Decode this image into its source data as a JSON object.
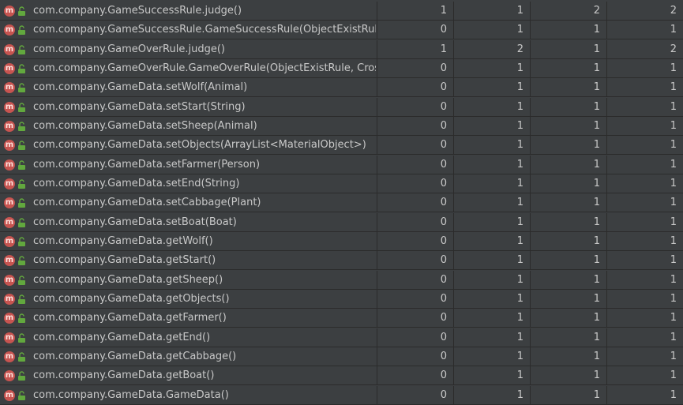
{
  "icons": {
    "method_icon": "m",
    "visibility_icon": "unlock-icon"
  },
  "colors": {
    "background": "#3c3f41",
    "grid": "#2b2b2b",
    "text": "#c8c8c8",
    "method_badge": "#c75450",
    "lock": "#62a83e"
  },
  "rows": [
    {
      "name": "com.company.GameSuccessRule.judge()",
      "v1": "1",
      "v2": "1",
      "v3": "2",
      "v4": "2"
    },
    {
      "name": "com.company.GameSuccessRule.GameSuccessRule(ObjectExistRule, CrossRiver",
      "v1": "0",
      "v2": "1",
      "v3": "1",
      "v4": "1"
    },
    {
      "name": "com.company.GameOverRule.judge()",
      "v1": "1",
      "v2": "2",
      "v3": "1",
      "v4": "2"
    },
    {
      "name": "com.company.GameOverRule.GameOverRule(ObjectExistRule, CrossRiverRule)",
      "v1": "0",
      "v2": "1",
      "v3": "1",
      "v4": "1"
    },
    {
      "name": "com.company.GameData.setWolf(Animal)",
      "v1": "0",
      "v2": "1",
      "v3": "1",
      "v4": "1"
    },
    {
      "name": "com.company.GameData.setStart(String)",
      "v1": "0",
      "v2": "1",
      "v3": "1",
      "v4": "1"
    },
    {
      "name": "com.company.GameData.setSheep(Animal)",
      "v1": "0",
      "v2": "1",
      "v3": "1",
      "v4": "1"
    },
    {
      "name": "com.company.GameData.setObjects(ArrayList<MaterialObject>)",
      "v1": "0",
      "v2": "1",
      "v3": "1",
      "v4": "1"
    },
    {
      "name": "com.company.GameData.setFarmer(Person)",
      "v1": "0",
      "v2": "1",
      "v3": "1",
      "v4": "1"
    },
    {
      "name": "com.company.GameData.setEnd(String)",
      "v1": "0",
      "v2": "1",
      "v3": "1",
      "v4": "1"
    },
    {
      "name": "com.company.GameData.setCabbage(Plant)",
      "v1": "0",
      "v2": "1",
      "v3": "1",
      "v4": "1"
    },
    {
      "name": "com.company.GameData.setBoat(Boat)",
      "v1": "0",
      "v2": "1",
      "v3": "1",
      "v4": "1"
    },
    {
      "name": "com.company.GameData.getWolf()",
      "v1": "0",
      "v2": "1",
      "v3": "1",
      "v4": "1"
    },
    {
      "name": "com.company.GameData.getStart()",
      "v1": "0",
      "v2": "1",
      "v3": "1",
      "v4": "1"
    },
    {
      "name": "com.company.GameData.getSheep()",
      "v1": "0",
      "v2": "1",
      "v3": "1",
      "v4": "1"
    },
    {
      "name": "com.company.GameData.getObjects()",
      "v1": "0",
      "v2": "1",
      "v3": "1",
      "v4": "1"
    },
    {
      "name": "com.company.GameData.getFarmer()",
      "v1": "0",
      "v2": "1",
      "v3": "1",
      "v4": "1"
    },
    {
      "name": "com.company.GameData.getEnd()",
      "v1": "0",
      "v2": "1",
      "v3": "1",
      "v4": "1"
    },
    {
      "name": "com.company.GameData.getCabbage()",
      "v1": "0",
      "v2": "1",
      "v3": "1",
      "v4": "1"
    },
    {
      "name": "com.company.GameData.getBoat()",
      "v1": "0",
      "v2": "1",
      "v3": "1",
      "v4": "1"
    },
    {
      "name": "com.company.GameData.GameData()",
      "v1": "0",
      "v2": "1",
      "v3": "1",
      "v4": "1"
    }
  ]
}
